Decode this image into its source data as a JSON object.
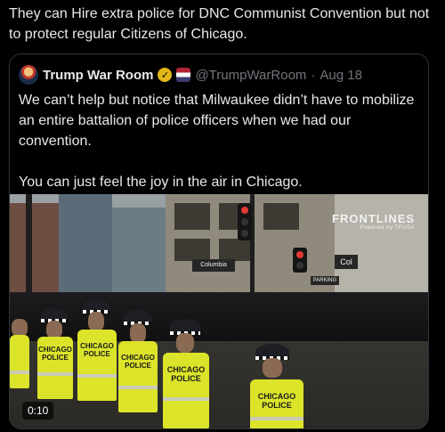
{
  "post": {
    "text": "They can Hire extra police for DNC Communist Convention but not to protect regular Citizens of Chicago."
  },
  "quote": {
    "display_name": "Trump War Room",
    "handle": "@TrumpWarRoom",
    "separator": "·",
    "date": "Aug 18",
    "paragraph1": "We can’t help but notice that Milwaukee didn’t have to mobilize an entire battalion of police officers when we had our convention.",
    "paragraph2": "You can just feel the joy in the air in Chicago."
  },
  "video": {
    "timestamp": "0:10",
    "watermark": "FRONTLINES",
    "watermark_sub": "Powered by TPUSA",
    "store_sign": "Columbia",
    "store_sign2": "Col",
    "street_sign": "PARKING",
    "vest_label": "CHICAGO POLICE"
  },
  "colors": {
    "background": "#000000",
    "text": "#e7e9ea",
    "muted": "#71767b",
    "border": "#2f3336",
    "verified_badge": "#e2b719",
    "vest": "#dce42a"
  },
  "icons": [
    "avatar",
    "verified-check-icon",
    "flag-affiliate-icon"
  ]
}
